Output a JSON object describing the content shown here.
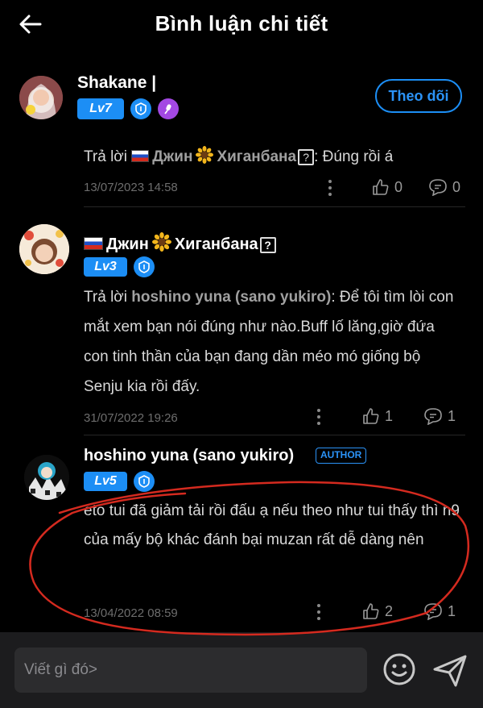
{
  "header": {
    "title": "Bình luận chi tiết"
  },
  "profile": {
    "name": "Shakane |",
    "level": "Lv7",
    "follow_label": "Theo dõi"
  },
  "comments": [
    {
      "reply_prefix": "Trả lời",
      "reply_to": "Джин",
      "reply_to_rest": "Хиганбана",
      "reply_text": ": Đúng rồi á",
      "time": "13/07/2023 14:58",
      "likes": "0",
      "replies": "0"
    },
    {
      "name": "Джин",
      "name_rest": "Хиганбана",
      "level": "Lv3",
      "reply_prefix": "Trả lời",
      "reply_to": "hoshino yuna (sano yukiro)",
      "body": ": Để tôi tìm lòi con mắt xem bạn nói đúng như nào.Buff lố lăng,giờ đứa con tinh thần của bạn đang dần méo mó giống bộ Senju kia rồi đấy.",
      "time": "31/07/2022 19:26",
      "likes": "1",
      "replies": "1"
    },
    {
      "name": "hoshino yuna (sano yukiro)",
      "author_tag": "AUTHOR",
      "level": "Lv5",
      "body": "eto tui đã giảm tải rồi đấu ạ nếu theo như tui thấy thì n9 của mấy bộ khác đánh bại muzan rất dễ dàng nên",
      "time": "13/04/2022 08:59",
      "likes": "2",
      "replies": "1"
    }
  ],
  "input": {
    "placeholder": "Viết gì đó>"
  },
  "colors": {
    "accent": "#1c8ef5",
    "annotation": "#d42a1f",
    "background": "#000000"
  }
}
